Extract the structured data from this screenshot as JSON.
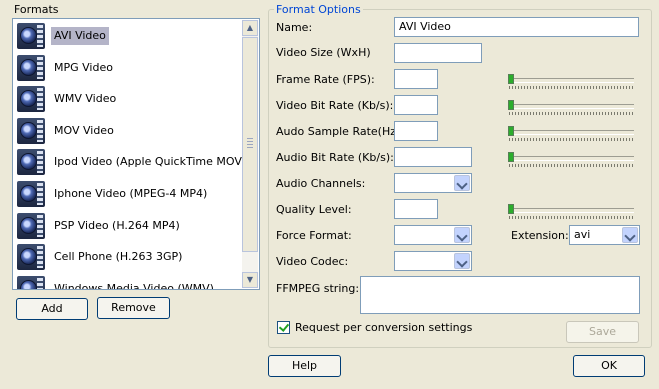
{
  "formats": {
    "label": "Formats",
    "items": [
      {
        "label": "AVI Video",
        "icon": "film-icon",
        "selected": true
      },
      {
        "label": "MPG Video",
        "icon": "film-icon"
      },
      {
        "label": "WMV Video",
        "icon": "film-icon"
      },
      {
        "label": "MOV Video",
        "icon": "film-icon"
      },
      {
        "label": "Ipod Video (Apple QuickTime MOV)",
        "icon": "film-icon"
      },
      {
        "label": "Iphone Video (MPEG-4 MP4)",
        "icon": "film-icon"
      },
      {
        "label": "PSP Video (H.264 MP4)",
        "icon": "film-icon"
      },
      {
        "label": "Cell Phone (H.263 3GP)",
        "icon": "film-icon"
      },
      {
        "label": "Windows Media Video (WMV)",
        "icon": "film-icon"
      }
    ],
    "add_label": "Add",
    "remove_label": "Remove"
  },
  "options": {
    "title": "Format Options",
    "name_label": "Name:",
    "name_value": "AVI Video",
    "video_size_label": "Video Size (WxH)",
    "video_size_value": "",
    "frame_rate_label": "Frame Rate (FPS):",
    "frame_rate_value": "",
    "video_bitrate_label": "Video Bit Rate (Kb/s):",
    "video_bitrate_value": "",
    "audio_sample_label": "Audo Sample Rate(Hz):",
    "audio_sample_value": "",
    "audio_bitrate_label": "Audio Bit Rate (Kb/s):",
    "audio_bitrate_value": "",
    "audio_channels_label": "Audio Channels:",
    "audio_channels_value": "",
    "quality_label": "Quality Level:",
    "quality_value": "",
    "force_format_label": "Force Format:",
    "force_format_value": "",
    "extension_label": "Extension:",
    "extension_value": "avi",
    "video_codec_label": "Video Codec:",
    "video_codec_value": "",
    "ffmpeg_label": "FFMPEG string:",
    "ffmpeg_value": "",
    "request_label": "Request per conversion settings",
    "request_checked": true,
    "save_label": "Save",
    "slider_levels": {
      "frame_rate": 0,
      "video_bitrate": 0,
      "audio_sample": 0,
      "audio_bitrate": 0,
      "quality": 0
    }
  },
  "footer": {
    "help_label": "Help",
    "ok_label": "OK"
  }
}
